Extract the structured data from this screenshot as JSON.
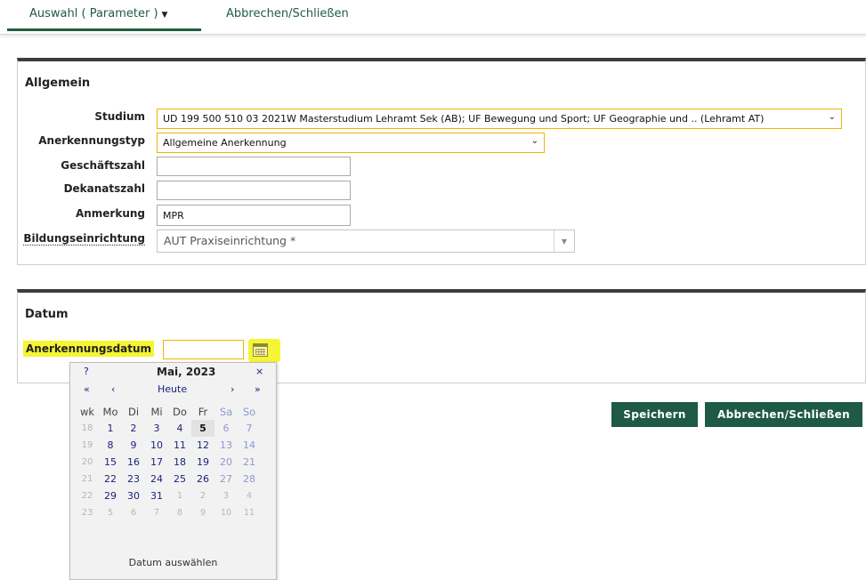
{
  "nav": {
    "selection_label": "Auswahl ( Parameter )",
    "cancel_label": "Abbrechen/Schließen"
  },
  "allgemein": {
    "title": "Allgemein",
    "studium_label": "Studium",
    "studium_value": "UD 199 500 510 03 2021W Masterstudium Lehramt Sek (AB); UF Bewegung und Sport; UF Geographie und .. (Lehramt AT)",
    "anerkennungstyp_label": "Anerkennungstyp",
    "anerkennungstyp_value": "Allgemeine Anerkennung",
    "geschaeftszahl_label": "Geschäftszahl",
    "geschaeftszahl_value": "",
    "dekanatszahl_label": "Dekanatszahl",
    "dekanatszahl_value": "",
    "anmerkung_label": "Anmerkung",
    "anmerkung_value": "MPR",
    "bildung_label": "Bildungseinrichtung",
    "bildung_value": "AUT Praxiseinrichtung *"
  },
  "datum": {
    "title": "Datum",
    "anerkennungsdatum_label": "Anerkennungsdatum",
    "anerkennungsdatum_value": ""
  },
  "buttons": {
    "save_label": "Speichern",
    "cancel_label": "Abbrechen/Schließen"
  },
  "calendar": {
    "help": "?",
    "month_year": "Mai, 2023",
    "close": "×",
    "prev_year": "«",
    "prev_month": "‹",
    "today": "Heute",
    "next_month": "›",
    "next_year": "»",
    "weekday_headers": [
      "wk",
      "Mo",
      "Di",
      "Mi",
      "Do",
      "Fr",
      "Sa",
      "So"
    ],
    "weeks": [
      {
        "wk": "18",
        "days": [
          "1",
          "2",
          "3",
          "4",
          "5",
          "6",
          "7"
        ]
      },
      {
        "wk": "19",
        "days": [
          "8",
          "9",
          "10",
          "11",
          "12",
          "13",
          "14"
        ]
      },
      {
        "wk": "20",
        "days": [
          "15",
          "16",
          "17",
          "18",
          "19",
          "20",
          "21"
        ]
      },
      {
        "wk": "21",
        "days": [
          "22",
          "23",
          "24",
          "25",
          "26",
          "27",
          "28"
        ]
      },
      {
        "wk": "22",
        "days": [
          "29",
          "30",
          "31",
          "1",
          "2",
          "3",
          "4"
        ]
      },
      {
        "wk": "23",
        "days": [
          "5",
          "6",
          "7",
          "8",
          "9",
          "10",
          "11"
        ]
      }
    ],
    "today_day": "5",
    "footer": "Datum auswählen"
  },
  "colors": {
    "brand_green": "#1e5a45",
    "highlight_yellow": "#f5f533",
    "field_border_yellow": "#f0b400"
  }
}
